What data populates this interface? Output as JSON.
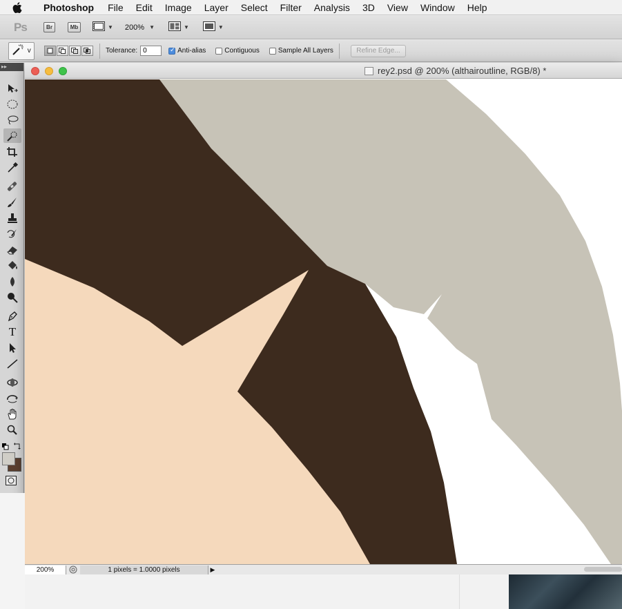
{
  "menubar": {
    "app_name": "Photoshop",
    "items": [
      "File",
      "Edit",
      "Image",
      "Layer",
      "Select",
      "Filter",
      "Analysis",
      "3D",
      "View",
      "Window",
      "Help"
    ]
  },
  "appbar": {
    "logo": "Ps",
    "bridge_label": "Br",
    "minibridge_label": "Mb",
    "zoom_value": "200%"
  },
  "options": {
    "tool_shortcut": "v",
    "tolerance_label": "Tolerance:",
    "tolerance_value": "0",
    "anti_alias_label": "Anti-alias",
    "anti_alias_checked": true,
    "contiguous_label": "Contiguous",
    "contiguous_checked": false,
    "sample_all_label": "Sample All Layers",
    "sample_all_checked": false,
    "refine_edge_label": "Refine Edge..."
  },
  "tools": {
    "active": "quick-selection",
    "items": [
      "move",
      "marquee",
      "lasso",
      "quick-selection",
      "crop",
      "eyedropper",
      "healing",
      "brush",
      "clone-stamp",
      "history-brush",
      "eraser",
      "paint-bucket",
      "blur",
      "dodge",
      "pen",
      "type",
      "path-selection",
      "line",
      "3d-rotate",
      "3d-orbit",
      "hand",
      "zoom"
    ],
    "type_glyph": "T"
  },
  "document": {
    "title": "rey2.psd @ 200% (althairoutline, RGB/8) *",
    "zoom": "200%",
    "status_info": "1 pixels = 1.0000 pixels"
  },
  "colors": {
    "hair": "#3d2b1e",
    "skin": "#f5d9bc",
    "outline_gray": "#c7c3b7",
    "canvas_bg": "#ffffff",
    "foreground_swatch": "#d0cec7",
    "background_swatch": "#5b3f2f",
    "close_light": "#ec5f56",
    "minimize_light": "#f6bd3f",
    "zoom_light": "#3fc34a"
  }
}
